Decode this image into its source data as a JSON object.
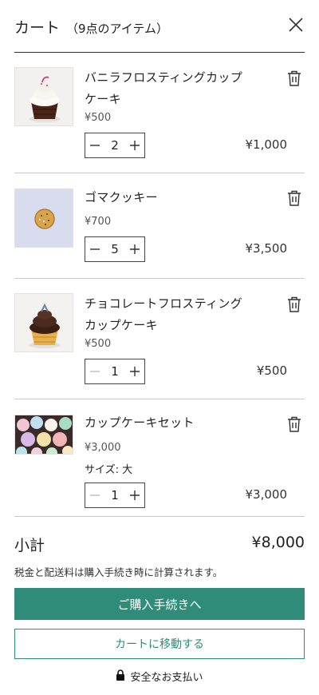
{
  "colors": {
    "accent": "#2e8c78",
    "accent_text": "#ffffff",
    "divider": "#c8c8c8"
  },
  "header": {
    "title": "カート",
    "item_count": "（9点のアイテム）",
    "close_icon": "close-icon"
  },
  "items": [
    {
      "name": "バニラフロスティングカップケーキ",
      "price": "¥500",
      "quantity": "2",
      "total": "¥1,000",
      "option": ""
    },
    {
      "name": "ゴマクッキー",
      "price": "¥700",
      "quantity": "5",
      "total": "¥3,500",
      "option": ""
    },
    {
      "name": "チョコレートフロスティングカップケーキ",
      "price": "¥500",
      "quantity": "1",
      "total": "¥500",
      "option": ""
    },
    {
      "name": "カップケーキセット",
      "price": "¥3,000",
      "quantity": "1",
      "total": "¥3,000",
      "option": "サイズ: 大"
    }
  ],
  "summary": {
    "subtotal_label": "小計",
    "subtotal_value": "¥8,000",
    "tax_note": "税金と配送料は購入手続き時に計算されます。"
  },
  "actions": {
    "checkout_label": "ご購入手続きへ",
    "view_cart_label": "カートに移動する"
  },
  "footer": {
    "secure_label": "安全なお支払い",
    "lock_icon": "lock-icon"
  }
}
